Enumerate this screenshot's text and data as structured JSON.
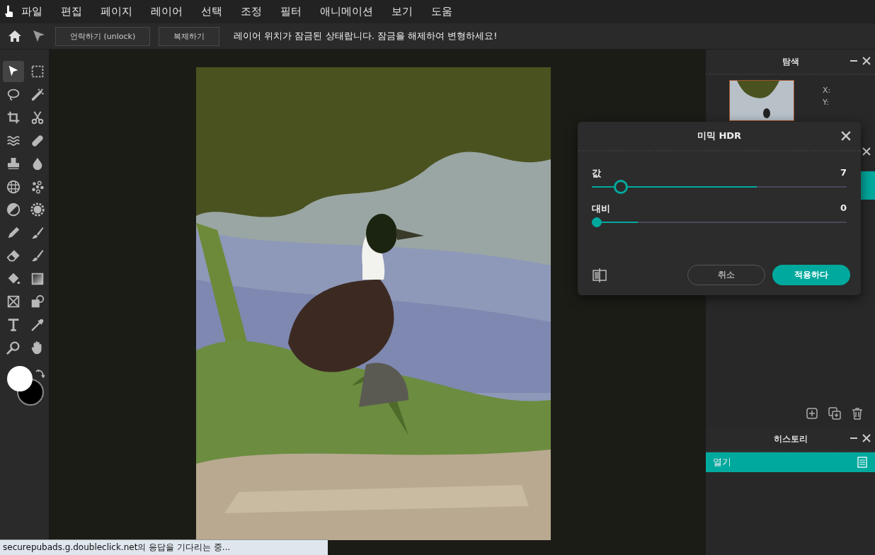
{
  "menu": [
    "파일",
    "편집",
    "페이지",
    "레이어",
    "선택",
    "조정",
    "필터",
    "애니메이션",
    "보기",
    "도움"
  ],
  "toolbar": {
    "buttons": [
      "언락하기 (unlock)",
      "복제하기"
    ],
    "message": "레이어 위치가 잠금된 상태랍니다. 잠금을 해제하여 변형하세요!"
  },
  "tools": [
    {
      "kind": "pointer",
      "selected": true
    },
    {
      "kind": "marquee",
      "selected": false
    },
    {
      "kind": "lasso",
      "selected": false
    },
    {
      "kind": "wand",
      "selected": false
    },
    {
      "kind": "crop",
      "selected": false
    },
    {
      "kind": "scissors",
      "selected": false
    },
    {
      "kind": "waves",
      "selected": false
    },
    {
      "kind": "bandage",
      "selected": false
    },
    {
      "kind": "stamp",
      "selected": false
    },
    {
      "kind": "drop",
      "selected": false
    },
    {
      "kind": "grid",
      "selected": false
    },
    {
      "kind": "dots",
      "selected": false
    },
    {
      "kind": "dodge",
      "selected": false
    },
    {
      "kind": "gear",
      "selected": false
    },
    {
      "kind": "pencil",
      "selected": false
    },
    {
      "kind": "brush",
      "selected": false
    },
    {
      "kind": "eraser",
      "selected": false
    },
    {
      "kind": "brush",
      "selected": false
    },
    {
      "kind": "bucket",
      "selected": false
    },
    {
      "kind": "gradient",
      "selected": false
    },
    {
      "kind": "frame",
      "selected": false
    },
    {
      "kind": "shape",
      "selected": false
    },
    {
      "kind": "text",
      "selected": false
    },
    {
      "kind": "picker",
      "selected": false
    },
    {
      "kind": "zoom",
      "selected": false
    },
    {
      "kind": "hand",
      "selected": false
    }
  ],
  "canvas": {
    "kind": "animal-picture"
  },
  "navigator": {
    "title": "탐색",
    "x_label": "X:",
    "y_label": "Y:"
  },
  "history": {
    "title": "히스토리",
    "items": [
      {
        "label": "열기",
        "selected": true
      }
    ]
  },
  "dialog": {
    "title": "미믹 HDR",
    "sliders": [
      {
        "label": "값",
        "reading": "7",
        "level": 0.09
      },
      {
        "label": "대비",
        "reading": "0",
        "level": 0
      }
    ],
    "buttons": [
      "취소",
      "적용하다"
    ]
  },
  "status_bar": "securepubads.g.doubleclick.net의 응답을 기다리는 중..."
}
